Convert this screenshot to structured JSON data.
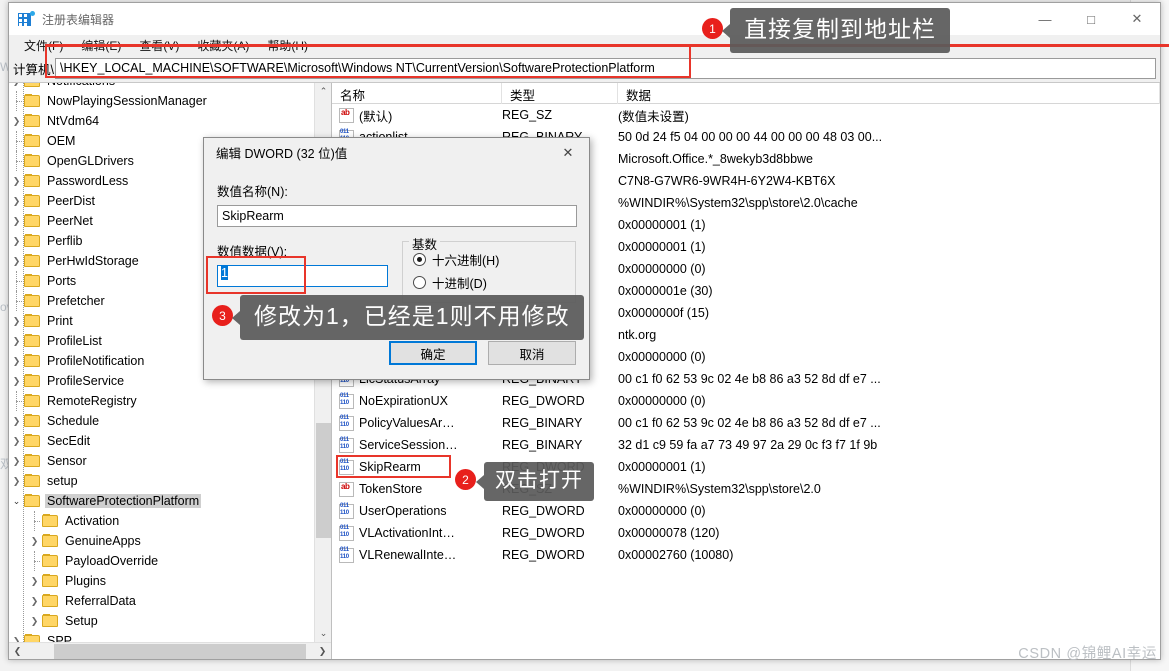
{
  "window": {
    "title": "注册表编辑器",
    "icon": "registry-editor-icon",
    "minimize": "—",
    "maximize": "□",
    "close": "✕"
  },
  "menubar": [
    {
      "label": "文件(F)"
    },
    {
      "label": "编辑(E)"
    },
    {
      "label": "查看(V)"
    },
    {
      "label": "收藏夹(A)"
    },
    {
      "label": "帮助(H)"
    }
  ],
  "address": {
    "prefix_label": "计算机\\",
    "value": "\\HKEY_LOCAL_MACHINE\\SOFTWARE\\Microsoft\\Windows NT\\CurrentVersion\\SoftwareProtectionPlatform",
    "placeholder": "计算机\\"
  },
  "tree": {
    "items": [
      {
        "label": "Notifications",
        "indent": 1,
        "twisty": "collapsed",
        "selected": false
      },
      {
        "label": "NowPlayingSessionManager",
        "indent": 1,
        "twisty": "none",
        "selected": false
      },
      {
        "label": "NtVdm64",
        "indent": 1,
        "twisty": "collapsed",
        "selected": false
      },
      {
        "label": "OEM",
        "indent": 1,
        "twisty": "none",
        "selected": false
      },
      {
        "label": "OpenGLDrivers",
        "indent": 1,
        "twisty": "none",
        "selected": false
      },
      {
        "label": "PasswordLess",
        "indent": 1,
        "twisty": "collapsed",
        "selected": false
      },
      {
        "label": "PeerDist",
        "indent": 1,
        "twisty": "collapsed",
        "selected": false
      },
      {
        "label": "PeerNet",
        "indent": 1,
        "twisty": "collapsed",
        "selected": false
      },
      {
        "label": "Perflib",
        "indent": 1,
        "twisty": "collapsed",
        "selected": false
      },
      {
        "label": "PerHwIdStorage",
        "indent": 1,
        "twisty": "collapsed",
        "selected": false
      },
      {
        "label": "Ports",
        "indent": 1,
        "twisty": "none",
        "selected": false
      },
      {
        "label": "Prefetcher",
        "indent": 1,
        "twisty": "none",
        "selected": false
      },
      {
        "label": "Print",
        "indent": 1,
        "twisty": "collapsed",
        "selected": false
      },
      {
        "label": "ProfileList",
        "indent": 1,
        "twisty": "collapsed",
        "selected": false
      },
      {
        "label": "ProfileNotification",
        "indent": 1,
        "twisty": "collapsed",
        "selected": false
      },
      {
        "label": "ProfileService",
        "indent": 1,
        "twisty": "collapsed",
        "selected": false
      },
      {
        "label": "RemoteRegistry",
        "indent": 1,
        "twisty": "none",
        "selected": false
      },
      {
        "label": "Schedule",
        "indent": 1,
        "twisty": "collapsed",
        "selected": false
      },
      {
        "label": "SecEdit",
        "indent": 1,
        "twisty": "collapsed",
        "selected": false
      },
      {
        "label": "Sensor",
        "indent": 1,
        "twisty": "collapsed",
        "selected": false
      },
      {
        "label": "setup",
        "indent": 1,
        "twisty": "collapsed",
        "selected": false
      },
      {
        "label": "SoftwareProtectionPlatform",
        "indent": 1,
        "twisty": "expanded",
        "selected": true
      },
      {
        "label": "Activation",
        "indent": 2,
        "twisty": "none",
        "selected": false
      },
      {
        "label": "GenuineApps",
        "indent": 2,
        "twisty": "collapsed",
        "selected": false
      },
      {
        "label": "PayloadOverride",
        "indent": 2,
        "twisty": "none",
        "selected": false
      },
      {
        "label": "Plugins",
        "indent": 2,
        "twisty": "collapsed",
        "selected": false
      },
      {
        "label": "ReferralData",
        "indent": 2,
        "twisty": "collapsed",
        "selected": false
      },
      {
        "label": "Setup",
        "indent": 2,
        "twisty": "collapsed",
        "selected": false
      },
      {
        "label": "SPP",
        "indent": 1,
        "twisty": "collapsed",
        "selected": false
      }
    ]
  },
  "values": {
    "columns": [
      "名称",
      "类型",
      "数据"
    ],
    "rows": [
      {
        "name": "(默认)",
        "icon": "string-value-icon",
        "type": "REG_SZ",
        "data": "(数值未设置)"
      },
      {
        "name": "actionlist",
        "icon": "binary-value-icon",
        "type": "REG_BINARY",
        "data": "50 0d 24 f5 04 00 00 00 44 00 00 00 48 03 00..."
      },
      {
        "name": "",
        "icon": "string-value-icon",
        "type": "",
        "data": "Microsoft.Office.*_8wekyb3d8bbwe"
      },
      {
        "name": "",
        "icon": "string-value-icon",
        "type": "",
        "data": "C7N8-G7WR6-9WR4H-6Y2W4-KBT6X"
      },
      {
        "name": "",
        "icon": "string-value-icon",
        "type": "",
        "data": "%WINDIR%\\System32\\spp\\store\\2.0\\cache"
      },
      {
        "name": "",
        "icon": "dword-value-icon",
        "type": "",
        "data": "0x00000001 (1)"
      },
      {
        "name": "",
        "icon": "dword-value-icon",
        "type": "",
        "data": "0x00000001 (1)"
      },
      {
        "name": "",
        "icon": "dword-value-icon",
        "type": "",
        "data": "0x00000000 (0)"
      },
      {
        "name": "",
        "icon": "dword-value-icon",
        "type": "",
        "data": "0x0000001e (30)"
      },
      {
        "name": "",
        "icon": "dword-value-icon",
        "type": "",
        "data": "0x0000000f (15)"
      },
      {
        "name": "",
        "icon": "string-value-icon",
        "type": "",
        "data": "ntk.org"
      },
      {
        "name": "",
        "icon": "dword-value-icon",
        "type": "",
        "data": "0x00000000 (0)"
      },
      {
        "name": "LicStatusArray",
        "icon": "binary-value-icon",
        "type": "REG_BINARY",
        "data": "00 c1 f0 62 53 9c 02 4e b8 86 a3 52 8d df e7 ..."
      },
      {
        "name": "NoExpirationUX",
        "icon": "dword-value-icon",
        "type": "REG_DWORD",
        "data": "0x00000000 (0)"
      },
      {
        "name": "PolicyValuesAr…",
        "icon": "binary-value-icon",
        "type": "REG_BINARY",
        "data": "00 c1 f0 62 53 9c 02 4e b8 86 a3 52 8d df e7 ..."
      },
      {
        "name": "ServiceSession…",
        "icon": "binary-value-icon",
        "type": "REG_BINARY",
        "data": "32 d1 c9 59 fa a7 73 49 97 2a 29 0c f3 f7 1f 9b"
      },
      {
        "name": "SkipRearm",
        "icon": "dword-value-icon",
        "type": "REG_DWORD",
        "data": "0x00000001 (1)",
        "highlighted": true
      },
      {
        "name": "TokenStore",
        "icon": "string-value-icon",
        "type": "REG_SZ",
        "data": "%WINDIR%\\System32\\spp\\store\\2.0"
      },
      {
        "name": "UserOperations",
        "icon": "dword-value-icon",
        "type": "REG_DWORD",
        "data": "0x00000000 (0)"
      },
      {
        "name": "VLActivationInt…",
        "icon": "dword-value-icon",
        "type": "REG_DWORD",
        "data": "0x00000078 (120)"
      },
      {
        "name": "VLRenewalInte…",
        "icon": "dword-value-icon",
        "type": "REG_DWORD",
        "data": "0x00002760 (10080)"
      }
    ]
  },
  "dialog": {
    "title": "编辑 DWORD (32 位)值",
    "close": "✕",
    "name_label": "数值名称(N):",
    "name_value": "SkipRearm",
    "data_label": "数值数据(V):",
    "data_value": "1",
    "base_legend": "基数",
    "base_options": [
      {
        "label": "十六进制(H)",
        "selected": true
      },
      {
        "label": "十进制(D)",
        "selected": false
      }
    ],
    "ok_label": "确定",
    "cancel_label": "取消"
  },
  "annotations": [
    {
      "number": "1",
      "text": "直接复制到地址栏"
    },
    {
      "number": "2",
      "text": "双击打开"
    },
    {
      "number": "3",
      "text": "修改为1，已经是1则不用修改"
    }
  ],
  "watermark": "CSDN @锦鲤AI幸运",
  "scroll": {
    "tree_up": "⌃",
    "tree_down": "⌄",
    "h_left": "❮",
    "h_right": "❯"
  },
  "colors": {
    "accent": "#0078d7",
    "annotation_red": "#e8352a",
    "badge_red": "#e8201c",
    "bubble_gray": "#5b5b5b",
    "folder": "#ffd666",
    "selection": "#cfcfcf"
  }
}
